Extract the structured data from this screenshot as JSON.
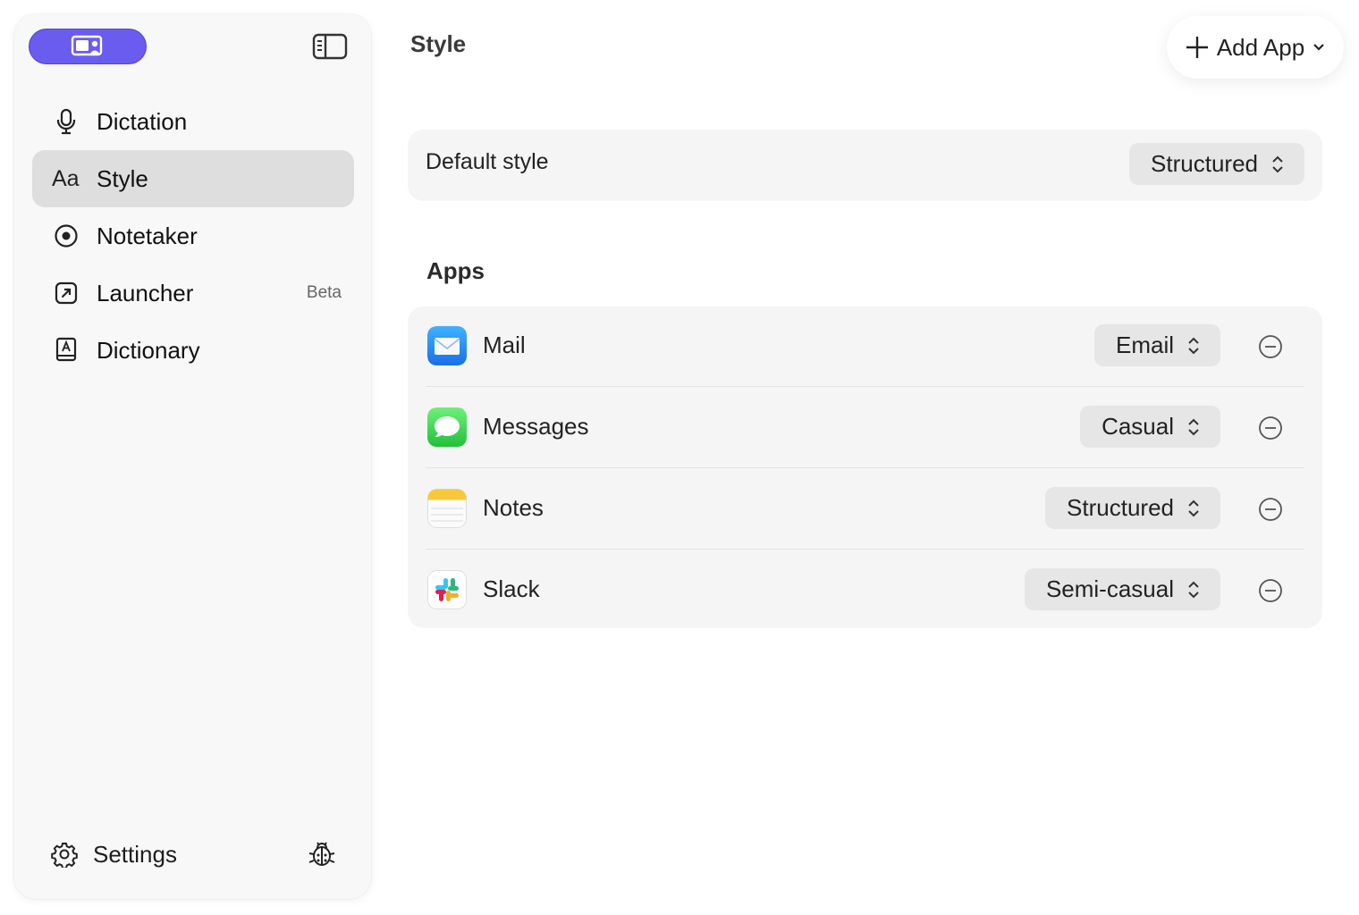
{
  "sidebar": {
    "items": [
      {
        "label": "Dictation",
        "icon": "microphone-icon"
      },
      {
        "label": "Style",
        "icon_text": "Aa",
        "active": true
      },
      {
        "label": "Notetaker",
        "icon": "record-icon"
      },
      {
        "label": "Launcher",
        "icon": "launch-icon",
        "badge": "Beta"
      },
      {
        "label": "Dictionary",
        "icon": "dictionary-icon"
      }
    ],
    "settings_label": "Settings"
  },
  "header": {
    "title": "Style",
    "add_app_label": "Add App"
  },
  "default_style": {
    "label": "Default style",
    "value": "Structured"
  },
  "apps": {
    "title": "Apps",
    "items": [
      {
        "name": "Mail",
        "style": "Email",
        "icon": "mail-app-icon"
      },
      {
        "name": "Messages",
        "style": "Casual",
        "icon": "messages-app-icon"
      },
      {
        "name": "Notes",
        "style": "Structured",
        "icon": "notes-app-icon"
      },
      {
        "name": "Slack",
        "style": "Semi-casual",
        "icon": "slack-app-icon"
      }
    ]
  },
  "colors": {
    "brand": "#6b5cf0",
    "active_item_bg": "#dedede",
    "card_bg": "#f5f5f5",
    "select_bg": "#e6e6e6"
  }
}
